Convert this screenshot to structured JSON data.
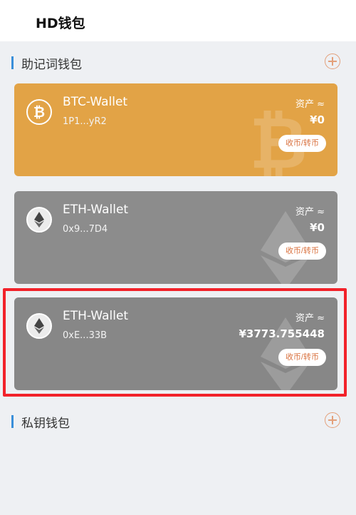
{
  "header": {
    "title": "HD钱包"
  },
  "sections": {
    "mnemonic": {
      "title": "助记词钱包"
    },
    "private_key": {
      "title": "私钥钱包"
    }
  },
  "wallets": [
    {
      "name": "BTC-Wallet",
      "address": "1P1...yR2",
      "asset_label": "资产 ≈",
      "asset_value": "¥0",
      "action_label": "收币/转币",
      "coin": "btc",
      "icon": "bitcoin-icon",
      "color": "#e2a346"
    },
    {
      "name": "ETH-Wallet",
      "address": "0x9...7D4",
      "asset_label": "资产 ≈",
      "asset_value": "¥0",
      "action_label": "收币/转币",
      "coin": "eth",
      "icon": "ethereum-icon",
      "color": "#8c8c8c"
    },
    {
      "name": "ETH-Wallet",
      "address": "0xE...33B",
      "asset_label": "资产 ≈",
      "asset_value": "¥3773.755448",
      "action_label": "收币/转币",
      "coin": "eth",
      "icon": "ethereum-icon",
      "color": "#878787",
      "highlighted": true
    }
  ],
  "colors": {
    "accent": "#e3a07a",
    "section_bar": "#3a8fd9",
    "highlight_border": "#f2222a"
  }
}
